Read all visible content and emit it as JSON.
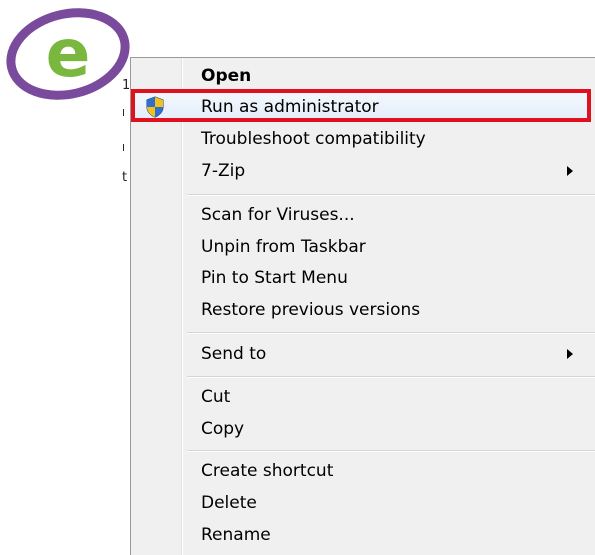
{
  "logo": {
    "letter": "e",
    "icon": "e-logo"
  },
  "background_fragments": [
    "1",
    "I",
    "I",
    "t"
  ],
  "menu": {
    "items": [
      {
        "label": "Open",
        "bold": true
      },
      {
        "label": "Run as administrator",
        "icon": "uac-shield-icon",
        "highlighted": true
      },
      {
        "label": "Troubleshoot compatibility"
      },
      {
        "label": "7-Zip",
        "submenu": true
      },
      {
        "label": "Scan for Viruses..."
      },
      {
        "label": "Unpin from Taskbar"
      },
      {
        "label": "Pin to Start Menu"
      },
      {
        "label": "Restore previous versions"
      },
      {
        "label": "Send to",
        "submenu": true
      },
      {
        "label": "Cut"
      },
      {
        "label": "Copy"
      },
      {
        "label": "Create shortcut"
      },
      {
        "label": "Delete"
      },
      {
        "label": "Rename"
      }
    ]
  },
  "colors": {
    "highlight_border": "#e0111f",
    "logo_green": "#7ab73e",
    "logo_purple": "#7a4b9c"
  }
}
